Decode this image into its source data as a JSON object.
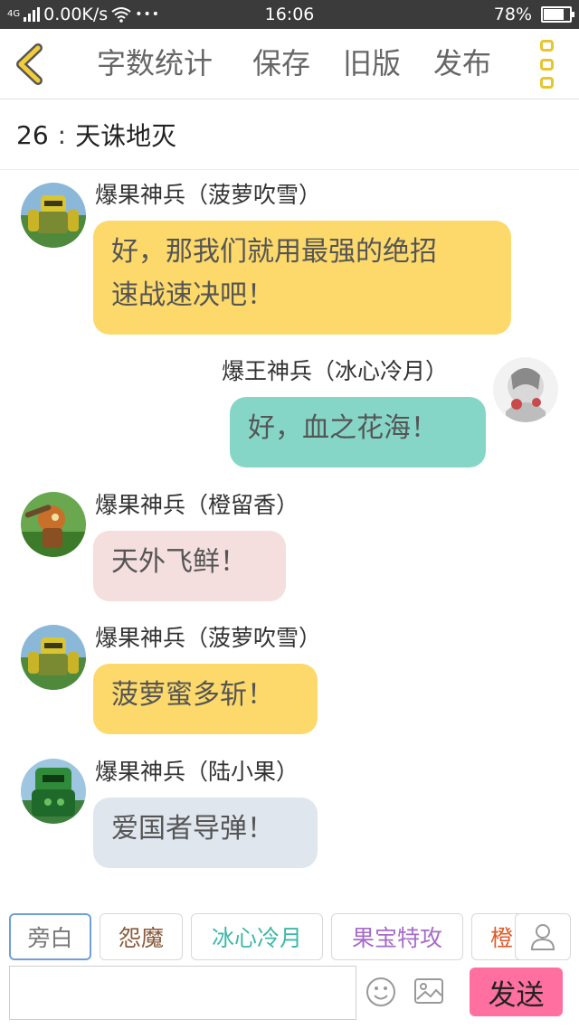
{
  "status_bar": {
    "network": "4G",
    "speed": "0.00K/s",
    "dots": "•••",
    "time": "16:06",
    "battery_text": "78%",
    "battery_level": 0.78
  },
  "toolbar": {
    "word_count": "字数统计",
    "save": "保存",
    "old_version": "旧版",
    "publish": "发布"
  },
  "scene": {
    "number": "26",
    "separator": ":",
    "title": "天诛地灭"
  },
  "messages": [
    {
      "sender": "爆果神兵（菠萝吹雪）",
      "text": "好，那我们就用最强的绝招\n速战速决吧！",
      "side": "left",
      "avatar": "pineapple-robot-avatar",
      "bubble_color": "#fcd96a"
    },
    {
      "sender": "爆王神兵（冰心冷月）",
      "text": "好，血之花海！",
      "side": "right",
      "avatar": "ice-heart-avatar",
      "bubble_color": "#86d6c8"
    },
    {
      "sender": "爆果神兵（橙留香）",
      "text": "天外飞鲜！",
      "side": "left",
      "avatar": "orange-robot-avatar",
      "bubble_color": "#f4dede"
    },
    {
      "sender": "爆果神兵（菠萝吹雪）",
      "text": "菠萝蜜多斩！",
      "side": "left",
      "avatar": "pineapple-robot-avatar",
      "bubble_color": "#fcd96a"
    },
    {
      "sender": "爆果神兵（陆小果）",
      "text": "爱国者导弹！",
      "side": "left",
      "avatar": "green-robot-avatar",
      "bubble_color": "#dfe6ee"
    }
  ],
  "character_chips": [
    {
      "label": "旁白",
      "color": "#777777",
      "selected": true
    },
    {
      "label": "怨魔",
      "color": "#8a5a3c",
      "selected": false
    },
    {
      "label": "冰心冷月",
      "color": "#3fb8a8",
      "selected": false
    },
    {
      "label": "果宝特攻",
      "color": "#a66cc8",
      "selected": false
    },
    {
      "label": "橙",
      "color": "#e05a2a",
      "selected": false
    }
  ],
  "composer": {
    "input_value": "",
    "send_label": "发送"
  },
  "colors": {
    "accent_yellow": "#e7c52c",
    "send_pink": "#ff6fa0",
    "status_bar_bg": "#3b3b3b"
  }
}
